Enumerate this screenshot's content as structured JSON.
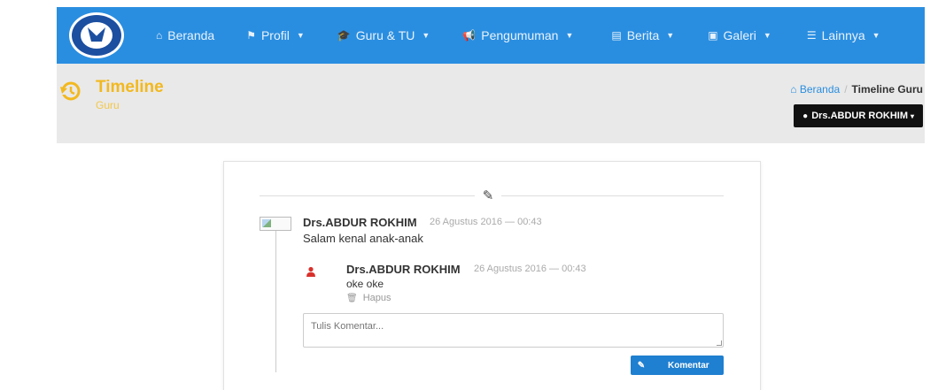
{
  "nav": {
    "items": [
      {
        "icon": "home-icon",
        "glyph": "⌂",
        "label": "Beranda",
        "caret": false
      },
      {
        "icon": "flag-icon",
        "glyph": "⚑",
        "label": "Profil",
        "caret": true
      },
      {
        "icon": "graduation-cap-icon",
        "glyph": "🎓",
        "label": "Guru & TU",
        "caret": true
      },
      {
        "icon": "bullhorn-icon",
        "glyph": "📢",
        "label": "Pengumuman",
        "caret": true
      },
      {
        "icon": "newspaper-icon",
        "glyph": "▤",
        "label": "Berita",
        "caret": true
      },
      {
        "icon": "picture-icon",
        "glyph": "▣",
        "label": "Galeri",
        "caret": true
      },
      {
        "icon": "list-icon",
        "glyph": "☰",
        "label": "Lainnya",
        "caret": true
      }
    ]
  },
  "header": {
    "title": "Timeline",
    "subtitle": "Guru",
    "breadcrumb": {
      "home": "Beranda",
      "current": "Timeline Guru"
    },
    "user_menu": "Drs.ABDUR ROKHIM"
  },
  "post": {
    "author": "Drs.ABDUR ROKHIM",
    "time": "26 Agustus 2016 — 00:43",
    "body": "Salam kenal anak-anak"
  },
  "reply": {
    "author": "Drs.ABDUR ROKHIM",
    "time": "26 Agustus 2016 — 00:43",
    "body": "oke oke",
    "delete_label": "Hapus"
  },
  "comment": {
    "placeholder": "Tulis Komentar...",
    "submit_label": "Komentar"
  },
  "colors": {
    "navbar": "#2a8ee0",
    "accent": "#f2b81e",
    "button": "#1f7fd0",
    "avatar": "#d9302b"
  }
}
